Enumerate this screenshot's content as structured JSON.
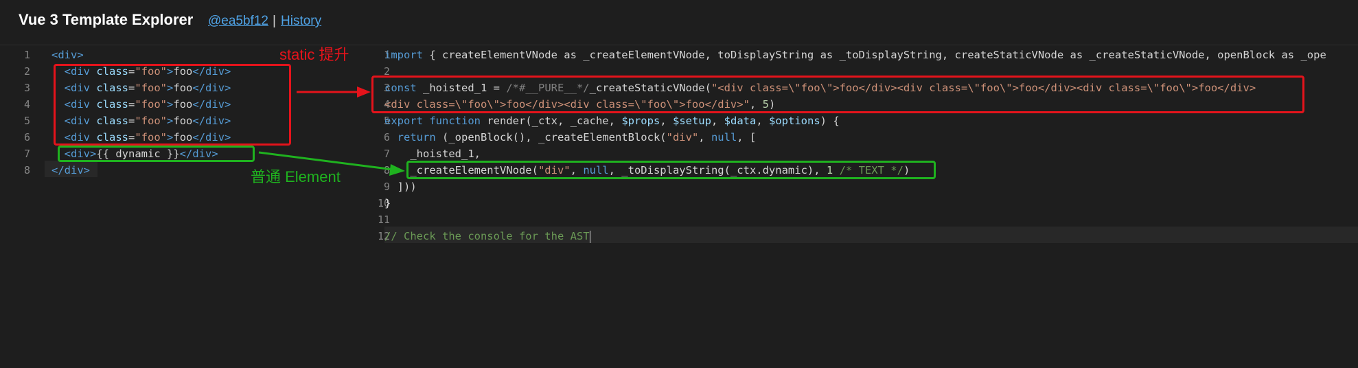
{
  "header": {
    "title": "Vue 3 Template Explorer",
    "commit": "@ea5bf12",
    "separator": "|",
    "history": "History"
  },
  "template_editor": {
    "line_numbers": [
      "1",
      "2",
      "3",
      "4",
      "5",
      "6",
      "7",
      "8"
    ],
    "lines": [
      [
        {
          "t": "<div>",
          "c": "tag"
        }
      ],
      [
        {
          "t": "  "
        },
        {
          "t": "<div ",
          "c": "tag"
        },
        {
          "t": "class",
          "c": "attr"
        },
        {
          "t": "=",
          "c": ""
        },
        {
          "t": "\"foo\"",
          "c": "str"
        },
        {
          "t": ">",
          "c": "tag"
        },
        {
          "t": "foo"
        },
        {
          "t": "</div>",
          "c": "tag"
        }
      ],
      [
        {
          "t": "  "
        },
        {
          "t": "<div ",
          "c": "tag"
        },
        {
          "t": "class",
          "c": "attr"
        },
        {
          "t": "=",
          "c": ""
        },
        {
          "t": "\"foo\"",
          "c": "str"
        },
        {
          "t": ">",
          "c": "tag"
        },
        {
          "t": "foo"
        },
        {
          "t": "</div>",
          "c": "tag"
        }
      ],
      [
        {
          "t": "  "
        },
        {
          "t": "<div ",
          "c": "tag"
        },
        {
          "t": "class",
          "c": "attr"
        },
        {
          "t": "=",
          "c": ""
        },
        {
          "t": "\"foo\"",
          "c": "str"
        },
        {
          "t": ">",
          "c": "tag"
        },
        {
          "t": "foo"
        },
        {
          "t": "</div>",
          "c": "tag"
        }
      ],
      [
        {
          "t": "  "
        },
        {
          "t": "<div ",
          "c": "tag"
        },
        {
          "t": "class",
          "c": "attr"
        },
        {
          "t": "=",
          "c": ""
        },
        {
          "t": "\"foo\"",
          "c": "str"
        },
        {
          "t": ">",
          "c": "tag"
        },
        {
          "t": "foo"
        },
        {
          "t": "</div>",
          "c": "tag"
        }
      ],
      [
        {
          "t": "  "
        },
        {
          "t": "<div ",
          "c": "tag"
        },
        {
          "t": "class",
          "c": "attr"
        },
        {
          "t": "=",
          "c": ""
        },
        {
          "t": "\"foo\"",
          "c": "str"
        },
        {
          "t": ">",
          "c": "tag"
        },
        {
          "t": "foo"
        },
        {
          "t": "</div>",
          "c": "tag"
        }
      ],
      [
        {
          "t": "  "
        },
        {
          "t": "<div>",
          "c": "tag"
        },
        {
          "t": "{{ dynamic }}"
        },
        {
          "t": "</div>",
          "c": "tag"
        }
      ],
      [
        {
          "t": "</div>",
          "c": "tag"
        }
      ]
    ]
  },
  "output_editor": {
    "line_numbers": [
      "1",
      "2",
      "3",
      "4",
      "5",
      "6",
      "7",
      "8",
      "9",
      "10",
      "11",
      "12"
    ],
    "lines": [
      [
        {
          "t": "import",
          "c": "kw"
        },
        {
          "t": " { createElementVNode as _createElementVNode, toDisplayString as _toDisplayString, createStaticVNode as _createStaticVNode, openBlock as _ope"
        }
      ],
      [],
      [
        {
          "t": "const",
          "c": "kw"
        },
        {
          "t": " _hoisted_1 = "
        },
        {
          "t": "/*#__PURE__*/",
          "c": "grey"
        },
        {
          "t": "_createStaticVNode("
        },
        {
          "t": "\"<div class=\\\"foo\\\">foo</div><div class=\\\"foo\\\">foo</div><div class=\\\"foo\\\">foo</div>",
          "c": "str"
        }
      ],
      [
        {
          "t": "<div class=\\\"foo\\\">foo</div><div class=\\\"foo\\\">foo</div>\"",
          "c": "str"
        },
        {
          "t": ", "
        },
        {
          "t": "5",
          "c": "num"
        },
        {
          "t": ")"
        }
      ],
      [
        {
          "t": "export",
          "c": "kw"
        },
        {
          "t": " "
        },
        {
          "t": "function",
          "c": "kw"
        },
        {
          "t": " render(_ctx, _cache, "
        },
        {
          "t": "$props",
          "c": "var"
        },
        {
          "t": ", "
        },
        {
          "t": "$setup",
          "c": "var"
        },
        {
          "t": ", "
        },
        {
          "t": "$data",
          "c": "var"
        },
        {
          "t": ", "
        },
        {
          "t": "$options",
          "c": "var"
        },
        {
          "t": ") {"
        }
      ],
      [
        {
          "t": "  "
        },
        {
          "t": "return",
          "c": "kw"
        },
        {
          "t": " (_openBlock(), _createElementBlock("
        },
        {
          "t": "\"div\"",
          "c": "str"
        },
        {
          "t": ", "
        },
        {
          "t": "null",
          "c": "kw"
        },
        {
          "t": ", ["
        }
      ],
      [
        {
          "t": "    _hoisted_1,"
        }
      ],
      [
        {
          "t": "    _createElementVNode("
        },
        {
          "t": "\"div\"",
          "c": "str"
        },
        {
          "t": ", "
        },
        {
          "t": "null",
          "c": "kw"
        },
        {
          "t": ", _toDisplayString(_ctx.dynamic), "
        },
        {
          "t": "1",
          "c": "num"
        },
        {
          "t": " "
        },
        {
          "t": "/* TEXT */",
          "c": "cmt"
        },
        {
          "t": ")"
        }
      ],
      [
        {
          "t": "  ]))"
        }
      ],
      [
        {
          "t": "}"
        }
      ],
      [],
      [
        {
          "t": "// Check the console for the AST",
          "c": "cmt"
        }
      ]
    ]
  },
  "annotations": {
    "static_label": "static 提升",
    "element_label": "普通 Element",
    "static_color": "#e5131b",
    "element_color": "#1fb21f"
  }
}
